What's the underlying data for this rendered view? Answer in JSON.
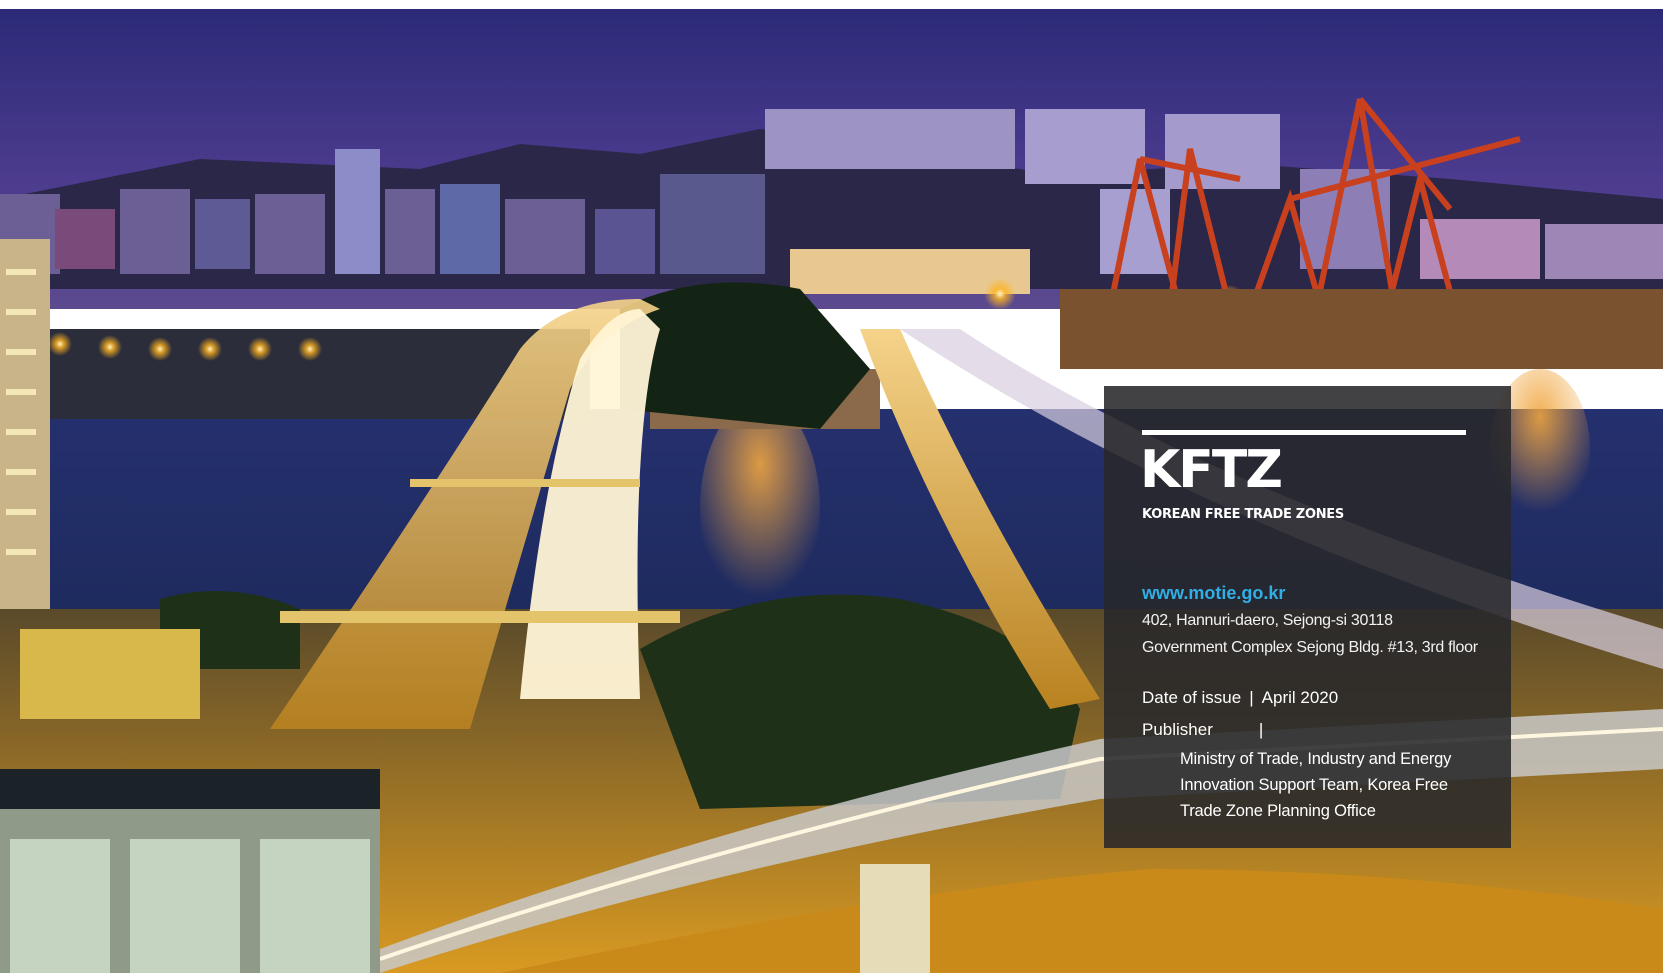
{
  "cover": {
    "title": "KFTZ",
    "subtitle": "KOREAN FREE TRADE ZONES",
    "website": "www.motie.go.kr",
    "address_line1": "402, Hannuri-daero, Sejong-si 30118",
    "address_line2": "Government Complex Sejong Bldg. #13, 3rd floor",
    "date_label": "Date of issue",
    "separator": "|",
    "date_value": "April 2020",
    "publisher_label": "Publisher",
    "publisher_lines": [
      "Ministry of Trade, Industry and Energy",
      "Innovation Support Team, Korea Free",
      "Trade Zone Planning Office"
    ]
  },
  "colors": {
    "accent_link": "#31aee6",
    "panel_background": "#28282a",
    "sky_top": "#2b2a78",
    "water": "#2a3a78",
    "light_glow": "#ffb320",
    "crane": "#c8401e"
  },
  "image": {
    "icon": "night-port-highway-photo"
  }
}
